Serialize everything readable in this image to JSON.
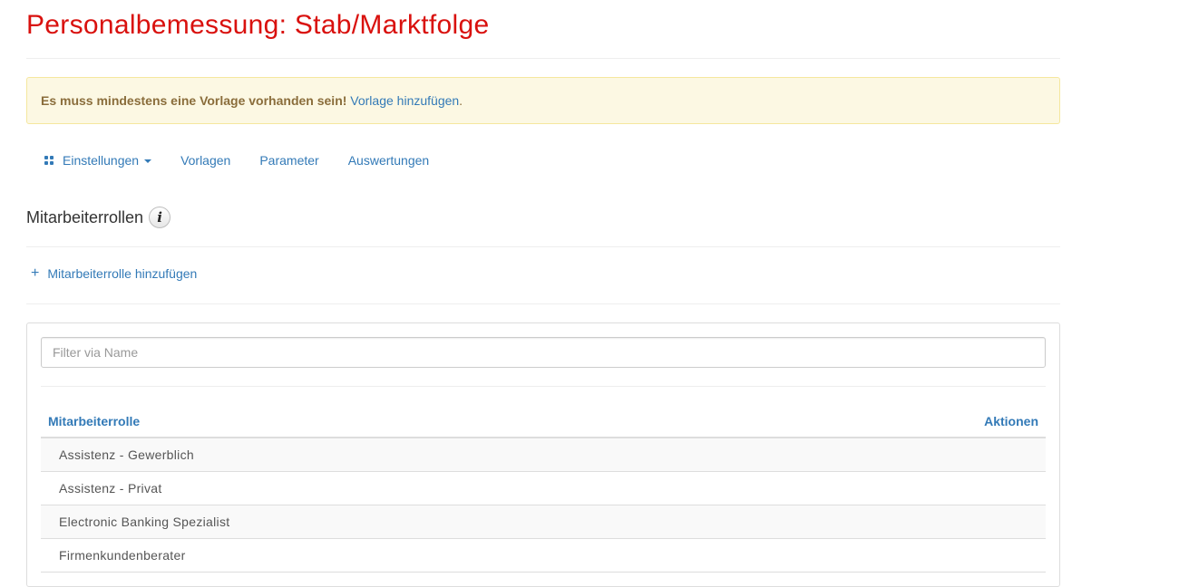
{
  "page": {
    "title": "Personalbemessung: Stab/Marktfolge"
  },
  "alert": {
    "strong": "Es muss mindestens eine Vorlage vorhanden sein!",
    "link": "Vorlage hinzufügen",
    "suffix": "."
  },
  "nav": {
    "dropdown_icon": "grid-icon",
    "items": [
      {
        "label": "Einstellungen"
      },
      {
        "label": "Vorlagen"
      },
      {
        "label": "Parameter"
      },
      {
        "label": "Auswertungen"
      }
    ]
  },
  "section": {
    "title": "Mitarbeiterrollen",
    "info_icon_glyph": "i",
    "add_label": "Mitarbeiterrolle hinzufügen",
    "add_icon_glyph": "+"
  },
  "filter": {
    "placeholder": "Filter via Name",
    "value": ""
  },
  "table": {
    "headers": {
      "role": "Mitarbeiterrolle",
      "actions": "Aktionen"
    },
    "rows": [
      {
        "name": "Assistenz - Gewerblich"
      },
      {
        "name": "Assistenz - Privat"
      },
      {
        "name": "Electronic Banking Spezialist"
      },
      {
        "name": "Firmenkundenberater"
      }
    ]
  },
  "colors": {
    "title": "#d9110e",
    "link": "#337ab7",
    "alert_bg": "#fcf8e3",
    "alert_text": "#8a6d3b"
  }
}
